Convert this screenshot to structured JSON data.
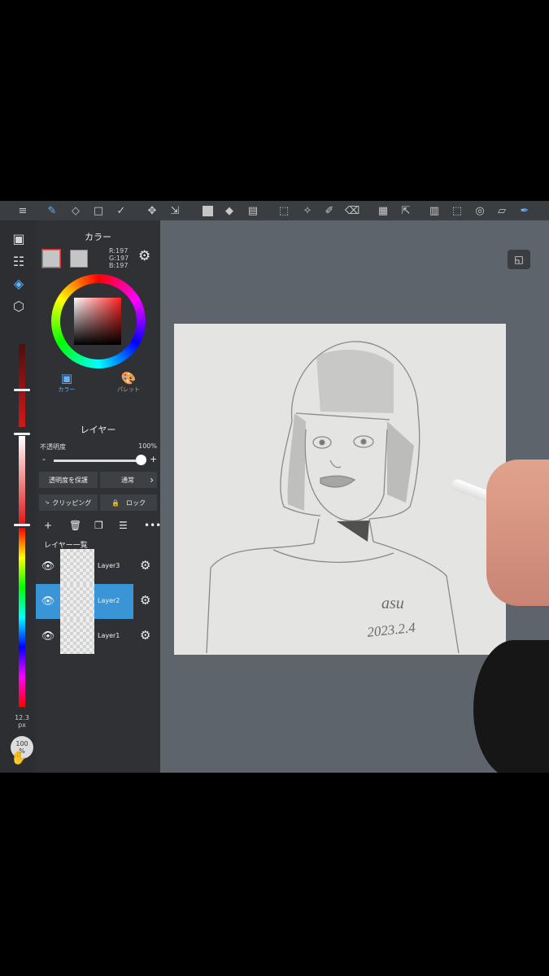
{
  "color_panel": {
    "title": "カラー",
    "rgb_r": "R:197",
    "rgb_g": "G:197",
    "rgb_b": "B:197",
    "current_color": "#c5c5c5",
    "tab_color": "カラー",
    "tab_palette": "パレット"
  },
  "layer_panel": {
    "title": "レイヤー",
    "opacity_label": "不透明度",
    "opacity_value": "100%",
    "opacity_fraction": 1.0,
    "minus": "-",
    "plus": "+",
    "protect_alpha": "透明度を保護",
    "blend_mode": "通常",
    "clipping": "クリッピング",
    "lock": "ロック",
    "list_title": "レイヤー一覧",
    "layers": [
      {
        "name": "Layer3",
        "selected": false
      },
      {
        "name": "Layer2",
        "selected": true
      },
      {
        "name": "Layer1",
        "selected": false
      }
    ]
  },
  "left_strip": {
    "brush_size": "12.3",
    "brush_size_unit": "px",
    "zoom": "100",
    "zoom_unit": "%"
  },
  "artwork": {
    "signature": "asu",
    "date": "2023.2.4"
  },
  "colors": {
    "selection_blue": "#3a95d6",
    "panel_bg": "#2f3135",
    "toolbar_bg": "#3a3d42"
  },
  "icons": {
    "toolbar": [
      "menu-icon",
      "brush-icon",
      "eraser-icon",
      "rectangle-icon",
      "select-pen-icon",
      "move-icon",
      "transform-icon",
      "fill-color-icon",
      "bucket-icon",
      "gradient-icon",
      "select-rect-icon",
      "magic-wand-icon",
      "select-pen2-icon",
      "select-eraser-icon",
      "panel-icon",
      "hand-select-icon",
      "page-icon",
      "deselect-icon",
      "undo-history-icon",
      "ruler-icon",
      "pen-settings-icon"
    ]
  }
}
